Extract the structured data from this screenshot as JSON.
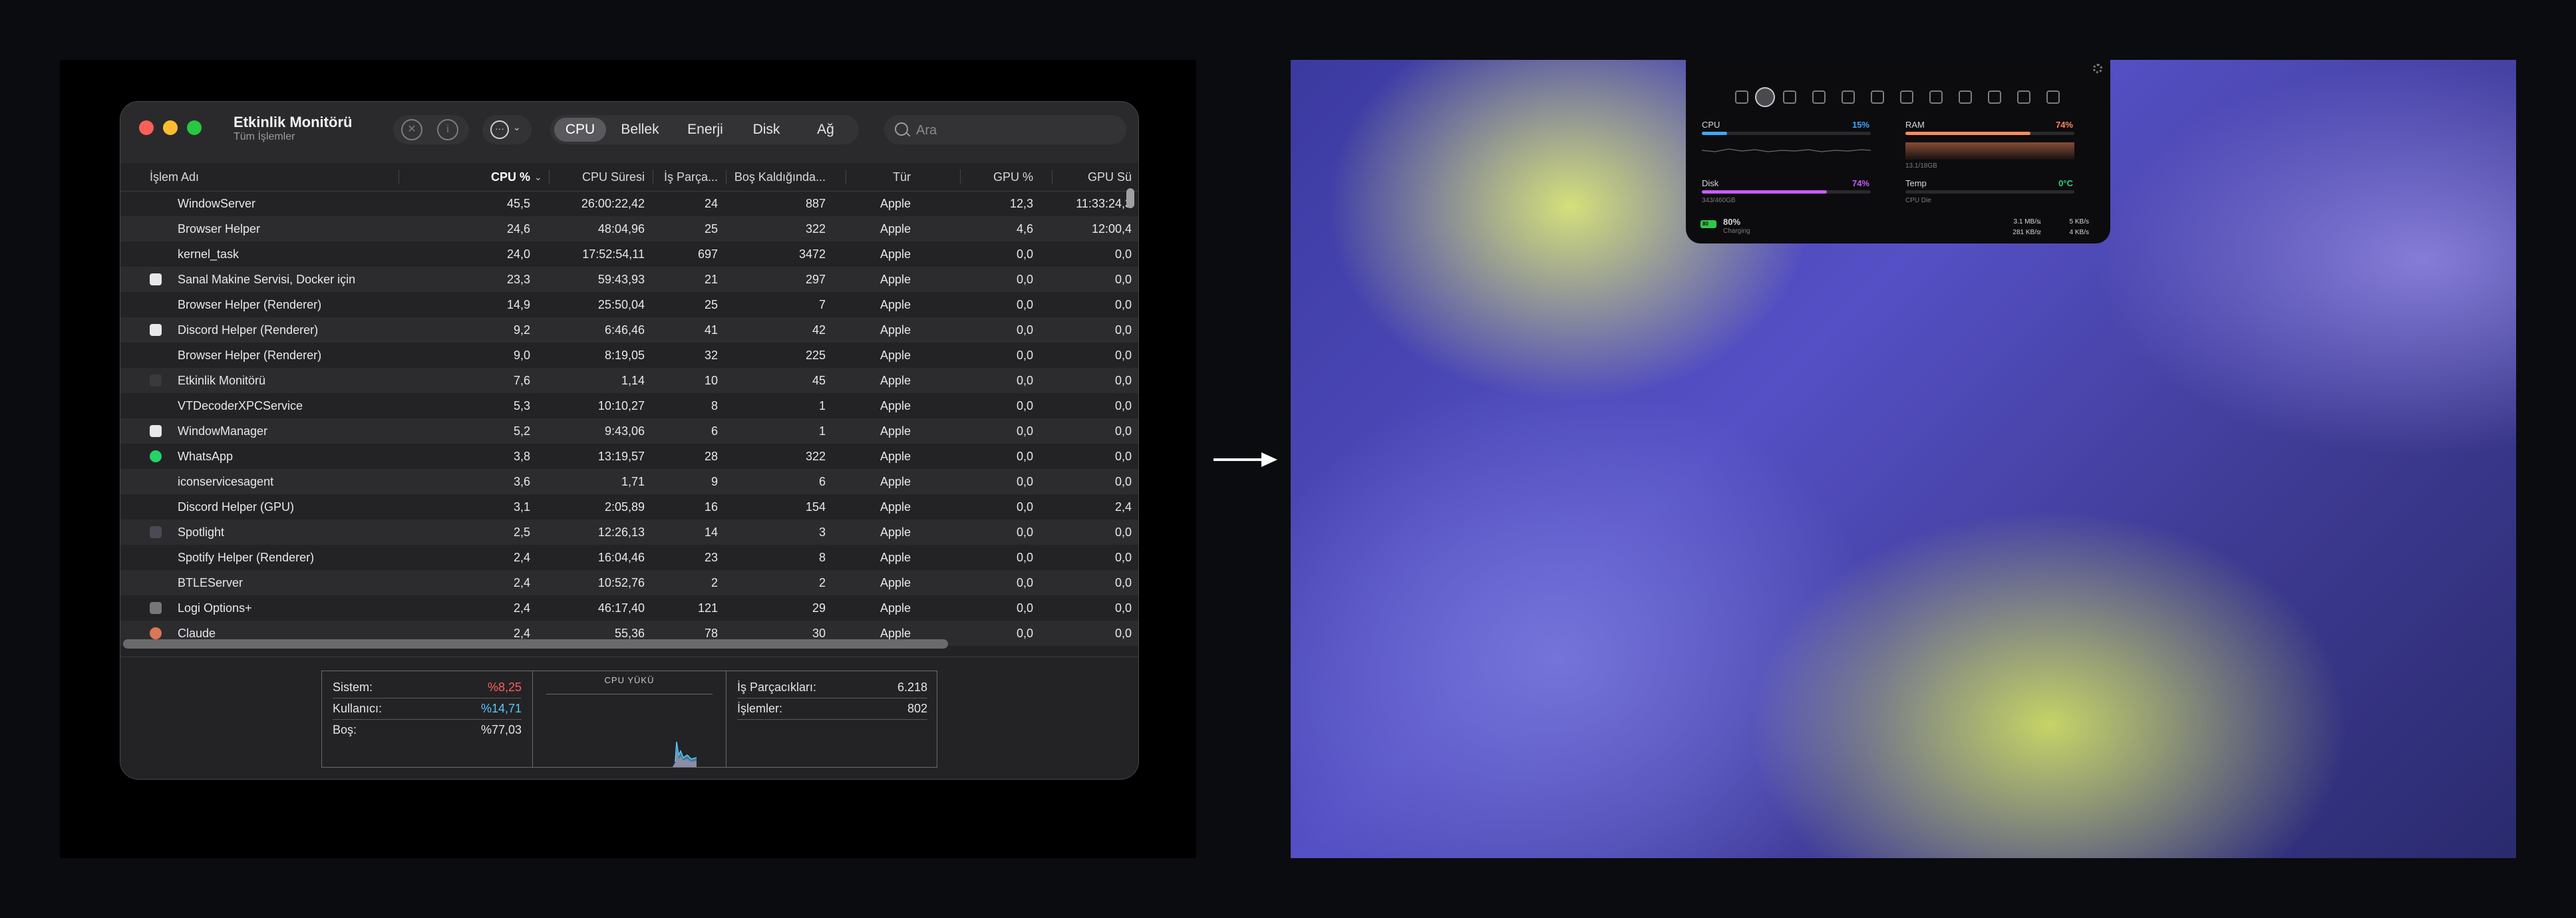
{
  "activity_monitor": {
    "title": "Etkinlik Monitörü",
    "subtitle": "Tüm İşlemler",
    "tabs": [
      {
        "label": "CPU",
        "active": true
      },
      {
        "label": "Bellek",
        "active": false
      },
      {
        "label": "Enerji",
        "active": false
      },
      {
        "label": "Disk",
        "active": false
      },
      {
        "label": "Ağ",
        "active": false
      }
    ],
    "search_placeholder": "Ara",
    "columns": [
      "İşlem Adı",
      "CPU %",
      "CPU Süresi",
      "İş Parça...",
      "Boş Kaldığında...",
      "Tür",
      "GPU %",
      "GPU Sü"
    ],
    "rows": [
      [
        "WindowServer",
        "45,5",
        "26:00:22,42",
        "24",
        "887",
        "Apple",
        "12,3",
        "11:33:24,3"
      ],
      [
        "Browser Helper",
        "24,6",
        "48:04,96",
        "25",
        "322",
        "Apple",
        "4,6",
        "12:00,4"
      ],
      [
        "kernel_task",
        "24,0",
        "17:52:54,11",
        "697",
        "3472",
        "Apple",
        "0,0",
        "0,0"
      ],
      [
        "Sanal Makine Servisi, Docker için",
        "23,3",
        "59:43,93",
        "21",
        "297",
        "Apple",
        "0,0",
        "0,0"
      ],
      [
        "Browser Helper (Renderer)",
        "14,9",
        "25:50,04",
        "25",
        "7",
        "Apple",
        "0,0",
        "0,0"
      ],
      [
        "Discord Helper (Renderer)",
        "9,2",
        "6:46,46",
        "41",
        "42",
        "Apple",
        "0,0",
        "0,0"
      ],
      [
        "Browser Helper (Renderer)",
        "9,0",
        "8:19,05",
        "32",
        "225",
        "Apple",
        "0,0",
        "0,0"
      ],
      [
        "Etkinlik Monitörü",
        "7,6",
        "1,14",
        "10",
        "45",
        "Apple",
        "0,0",
        "0,0"
      ],
      [
        "VTDecoderXPCService",
        "5,3",
        "10:10,27",
        "8",
        "1",
        "Apple",
        "0,0",
        "0,0"
      ],
      [
        "WindowManager",
        "5,2",
        "9:43,06",
        "6",
        "1",
        "Apple",
        "0,0",
        "0,0"
      ],
      [
        "WhatsApp",
        "3,8",
        "13:19,57",
        "28",
        "322",
        "Apple",
        "0,0",
        "0,0"
      ],
      [
        "iconservicesagent",
        "3,6",
        "1,71",
        "9",
        "6",
        "Apple",
        "0,0",
        "0,0"
      ],
      [
        "Discord Helper (GPU)",
        "3,1",
        "2:05,89",
        "16",
        "154",
        "Apple",
        "0,0",
        "2,4"
      ],
      [
        "Spotlight",
        "2,5",
        "12:26,13",
        "14",
        "3",
        "Apple",
        "0,0",
        "0,0"
      ],
      [
        "Spotify Helper (Renderer)",
        "2,4",
        "16:04,46",
        "23",
        "8",
        "Apple",
        "0,0",
        "0,0"
      ],
      [
        "BTLEServer",
        "2,4",
        "10:52,76",
        "2",
        "2",
        "Apple",
        "0,0",
        "0,0"
      ],
      [
        "Logi Options+",
        "2,4",
        "46:17,40",
        "121",
        "29",
        "Apple",
        "0,0",
        "0,0"
      ],
      [
        "Claude",
        "2,4",
        "55,36",
        "78",
        "30",
        "Apple",
        "0,0",
        "0,0"
      ]
    ],
    "row_icons": [
      "",
      "",
      "",
      "white",
      "",
      "white",
      "",
      "monitor",
      "",
      "white",
      "whatsapp",
      "",
      "",
      "spotlight",
      "",
      "",
      "logi",
      "claude"
    ],
    "summary": {
      "sistem_label": "Sistem:",
      "sistem_value": "%8,25",
      "kullanici_label": "Kullanıcı:",
      "kullanici_value": "%14,71",
      "bos_label": "Boş:",
      "bos_value": "%77,03",
      "cpu_load_title": "CPU YÜKÜ",
      "threads_label": "İş Parçacıkları:",
      "threads_value": "6.218",
      "processes_label": "İşlemler:",
      "processes_value": "802"
    },
    "colors": {
      "sistem": "#ff5c5c",
      "kullanici": "#5ac8fa"
    }
  },
  "stats_widget": {
    "cpu_label": "CPU",
    "cpu_value": "15%",
    "cpu_fraction": 0.15,
    "ram_label": "RAM",
    "ram_value": "74%",
    "ram_fraction": 0.74,
    "ram_detail": "13.1/18GB",
    "disk_label": "Disk",
    "disk_value": "74%",
    "disk_fraction": 0.74,
    "disk_detail": "343/460GB",
    "temp_label": "Temp",
    "temp_value": "0°C",
    "temp_detail": "CPU Die",
    "battery_value": "80%",
    "battery_status": "Charging",
    "battery_badge": "80",
    "net_down_rate": "3.1 MB/s",
    "net_up_rate": "281 KB/s",
    "net_down_total": "5 KB/s",
    "net_up_total": "4 KB/s",
    "down_arrow": "↓",
    "up_arrow": "↑",
    "colors": {
      "cpu": "#3ea8ff",
      "ram": "#ff8a5c",
      "disk": "#c85cff",
      "temp": "#33d17a"
    }
  }
}
